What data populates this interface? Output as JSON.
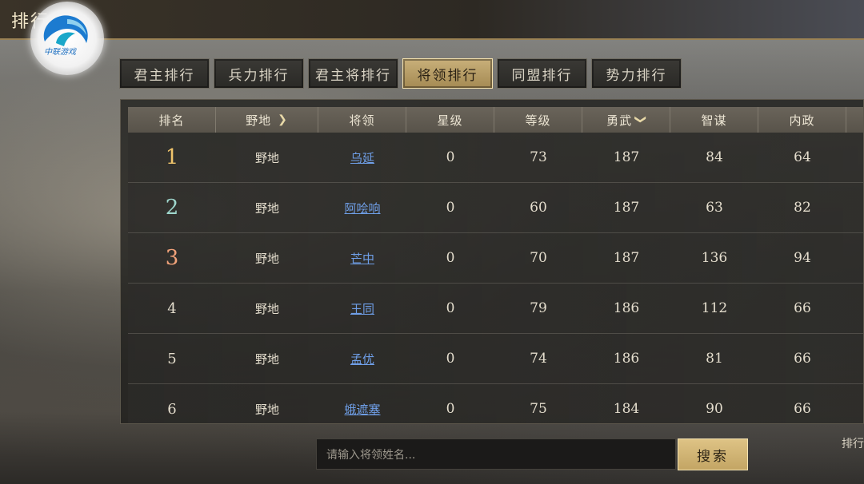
{
  "page_title": "排行",
  "logo": {
    "text": "中联游戏"
  },
  "tabs": [
    {
      "label": "君主排行",
      "active": false
    },
    {
      "label": "兵力排行",
      "active": false
    },
    {
      "label": "君主将排行",
      "active": false
    },
    {
      "label": "将领排行",
      "active": true
    },
    {
      "label": "同盟排行",
      "active": false
    },
    {
      "label": "势力排行",
      "active": false
    }
  ],
  "table": {
    "headers": [
      "排名",
      "野地",
      "将领",
      "星级",
      "等级",
      "勇武",
      "智谋",
      "内政"
    ],
    "rows": [
      {
        "rank": "1",
        "area": "野地",
        "general": "乌延",
        "star": "0",
        "level": "73",
        "valor": "187",
        "wisdom": "84",
        "politics": "64"
      },
      {
        "rank": "2",
        "area": "野地",
        "general": "阿哙响",
        "star": "0",
        "level": "60",
        "valor": "187",
        "wisdom": "63",
        "politics": "82"
      },
      {
        "rank": "3",
        "area": "野地",
        "general": "芒中",
        "star": "0",
        "level": "70",
        "valor": "187",
        "wisdom": "136",
        "politics": "94"
      },
      {
        "rank": "4",
        "area": "野地",
        "general": "王同",
        "star": "0",
        "level": "79",
        "valor": "186",
        "wisdom": "112",
        "politics": "66"
      },
      {
        "rank": "5",
        "area": "野地",
        "general": "孟优",
        "star": "0",
        "level": "74",
        "valor": "186",
        "wisdom": "81",
        "politics": "66"
      },
      {
        "rank": "6",
        "area": "野地",
        "general": "蛾遮塞",
        "star": "0",
        "level": "75",
        "valor": "184",
        "wisdom": "90",
        "politics": "66"
      }
    ]
  },
  "search": {
    "placeholder": "请输入将领姓名...",
    "button_label": "搜索"
  },
  "side_label": "排行",
  "colors": {
    "gold_accent": "#c9b07a",
    "link_blue": "#6f9fe8",
    "rank1": "#f0c46b",
    "rank2": "#9fd7cd",
    "rank3": "#f1a27a"
  }
}
